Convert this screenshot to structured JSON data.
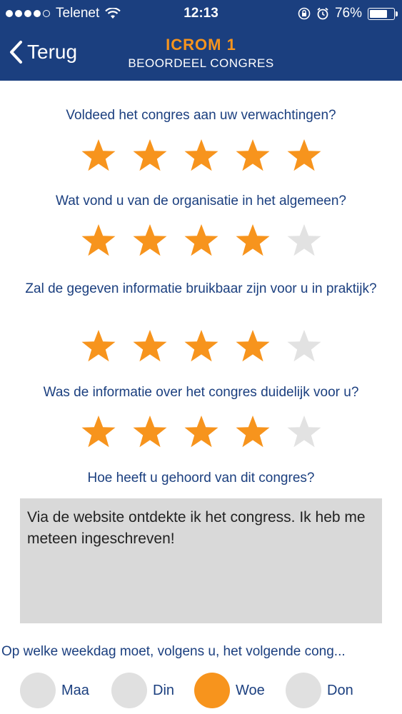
{
  "status_bar": {
    "carrier": "Telenet",
    "time": "12:13",
    "battery": "76%",
    "battery_level": 0.76
  },
  "nav": {
    "back_label": "Terug",
    "title": "ICROM 1",
    "subtitle": "BEOORDEEL CONGRES"
  },
  "questions": [
    {
      "text": "Voldeed het congres aan uw verwachtingen?",
      "rating": 5,
      "max": 5
    },
    {
      "text": "Wat vond u van de organisatie in het algemeen?",
      "rating": 4,
      "max": 5
    },
    {
      "text": "Zal de gegeven informatie bruikbaar zijn voor u in praktijk?",
      "rating": 4,
      "max": 5
    },
    {
      "text": "Was de informatie over het congres duidelijk voor u?",
      "rating": 4,
      "max": 5
    }
  ],
  "heard_question": "Hoe heeft u gehoord van dit congres?",
  "heard_answer": "Via de website ontdekte ik het congress. Ik heb me meteen ingeschreven!",
  "weekday_question": "Op welke weekdag moet, volgens u, het volgende cong...",
  "weekday_options": [
    {
      "label": "Maa",
      "selected": false
    },
    {
      "label": "Din",
      "selected": false
    },
    {
      "label": "Woe",
      "selected": true
    },
    {
      "label": "Don",
      "selected": false
    }
  ],
  "colors": {
    "header": "#1b3f7f",
    "accent": "#f7941d",
    "star_off": "#e2e2e2",
    "text": "#1b3f7f"
  }
}
